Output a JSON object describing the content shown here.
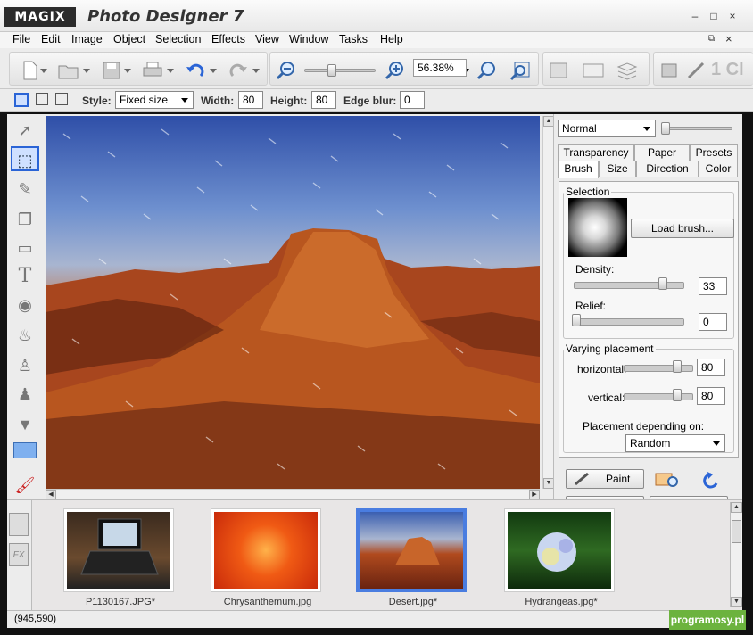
{
  "app": {
    "logo": "MAGIX",
    "title": "Photo Designer 7"
  },
  "window_controls": {
    "minimize": "–",
    "maximize": "□",
    "close": "×"
  },
  "menu": [
    "File",
    "Edit",
    "Image",
    "Object",
    "Selection",
    "Effects",
    "View",
    "Window",
    "Tasks",
    "Help"
  ],
  "mdi_controls": {
    "restore": "⧉",
    "close": "×"
  },
  "toolbar": {
    "zoom": "56.38%",
    "logo_text": "1 Cl"
  },
  "options": {
    "style_label": "Style:",
    "style_value": "Fixed size",
    "width_label": "Width:",
    "width_value": "80",
    "height_label": "Height:",
    "height_value": "80",
    "edge_blur_label": "Edge blur:",
    "edge_blur_value": "0"
  },
  "brush_panel": {
    "blend_mode": "Normal",
    "tabs_top": [
      "Transparency",
      "Paper",
      "Presets"
    ],
    "tabs_bottom": [
      "Brush",
      "Size",
      "Direction",
      "Color"
    ],
    "selection_legend": "Selection",
    "load_brush": "Load brush...",
    "density_label": "Density:",
    "density_value": "33",
    "relief_label": "Relief:",
    "relief_value": "0",
    "varying_legend": "Varying placement",
    "horizontal_label": "horizontal:",
    "horizontal_value": "80",
    "vertical_label": "vertical:",
    "vertical_value": "80",
    "placement_label": "Placement depending on:",
    "placement_value": "Random",
    "paint_button": "Paint"
  },
  "filmstrip": [
    {
      "label": "P1130167.JPG*"
    },
    {
      "label": "Chrysanthemum.jpg"
    },
    {
      "label": "Desert.jpg*"
    },
    {
      "label": "Hydrangeas.jpg*"
    }
  ],
  "status": {
    "coords": "(945,590)"
  },
  "watermark": "programosy.pl",
  "colors": {
    "accent": "#2a64d6",
    "selection": "#4a7de0",
    "watermark": "#6cb33e"
  }
}
